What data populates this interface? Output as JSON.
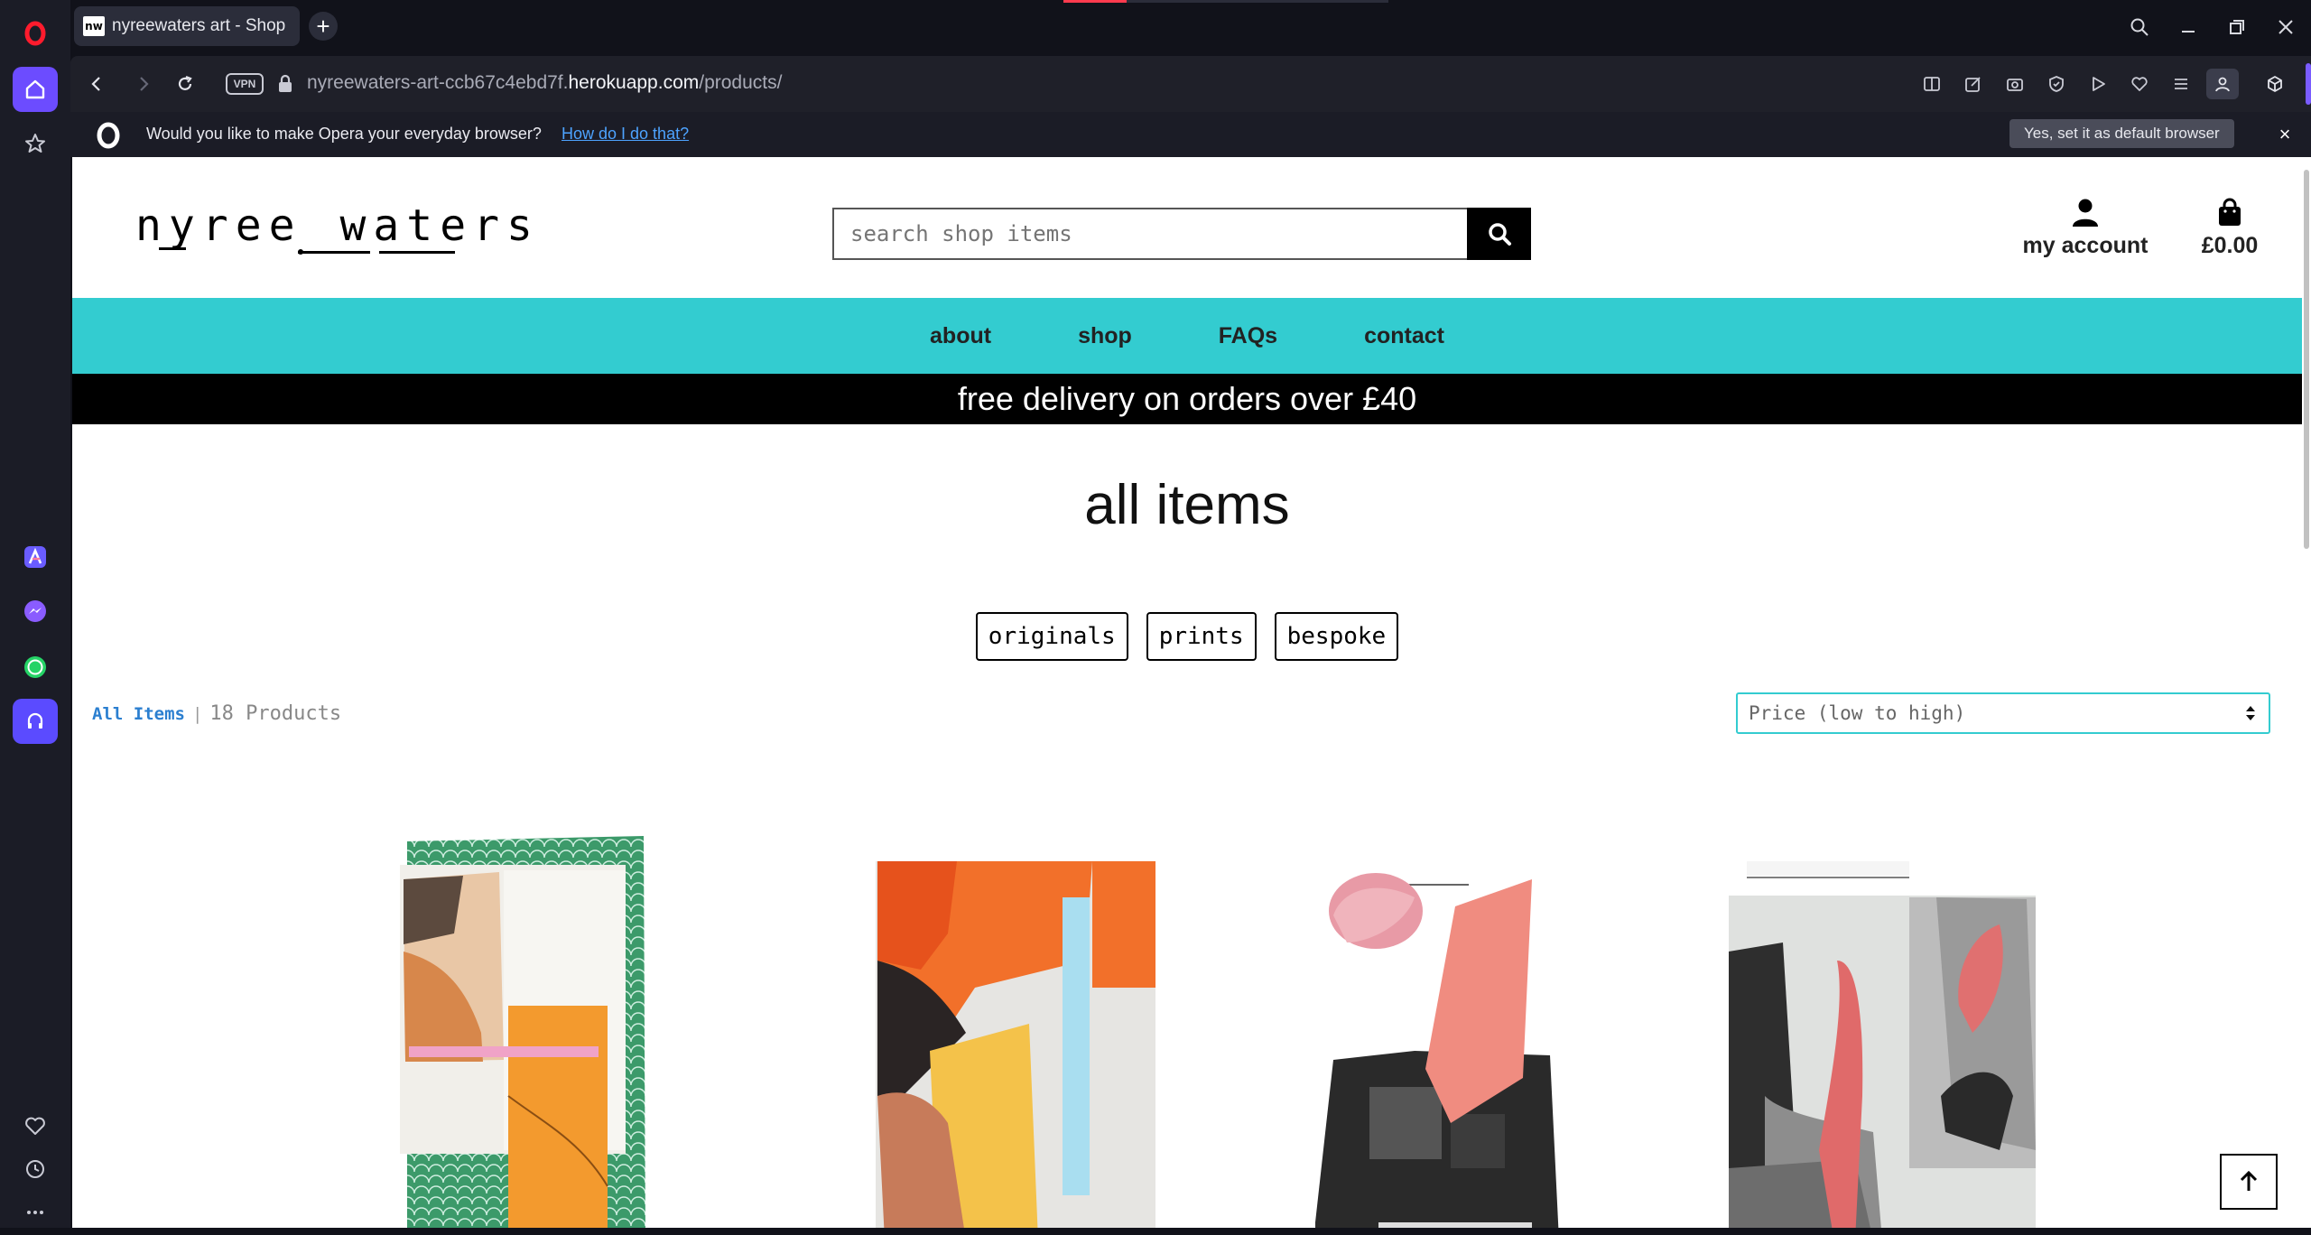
{
  "browser": {
    "tab": {
      "favicon_text": "nw",
      "title": "nyreewaters art - Shop"
    },
    "new_tab_symbol": "+",
    "vpn_label": "VPN",
    "url": {
      "prefix": "nyreewaters-art-ccb67c4ebd7f.",
      "domain": "herokuapp.com",
      "path": "/products/"
    },
    "default_prompt": {
      "text": "Would you like to make Opera your everyday browser?",
      "link": "How do I do that?",
      "button": "Yes, set it as default browser",
      "close": "×"
    }
  },
  "site": {
    "logo": {
      "word1": "nyree",
      "word2": "waters"
    },
    "search": {
      "placeholder": "search shop items",
      "value": ""
    },
    "account_label": "my account",
    "bag_total": "£0.00",
    "nav": [
      "about",
      "shop",
      "FAQs",
      "contact"
    ],
    "promo": "free delivery on orders over £40",
    "page_title": "all items",
    "filters": [
      "originals",
      "prints",
      "bespoke"
    ],
    "count": {
      "link": "All Items",
      "separator": "|",
      "text": "18 Products"
    },
    "sort": {
      "selected": "Price (low to high)"
    }
  },
  "colors": {
    "accent": "#33ccd0",
    "link": "#2b7fd0",
    "promo_bg": "#000000"
  },
  "icons": {
    "sidebar": [
      "opera-logo-icon",
      "home-icon",
      "star-icon",
      "aria-icon",
      "messenger-icon",
      "whatsapp-icon",
      "music-player-icon",
      "heart-icon",
      "history-icon",
      "more-icon"
    ],
    "toolbar": [
      "reader-icon",
      "edit-icon",
      "camera-icon",
      "shield-icon",
      "play-icon",
      "heart-icon",
      "easy-setup-icon",
      "profile-icon",
      "cube-icon"
    ]
  }
}
